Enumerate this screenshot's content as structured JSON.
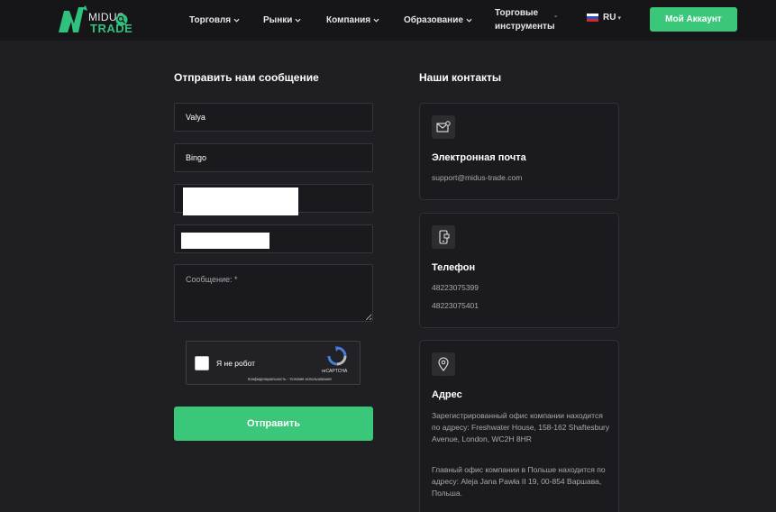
{
  "header": {
    "logo": {
      "word_top": "MIDUS",
      "word_bottom": "TRADE",
      "accent": "#2ec27e"
    },
    "nav": [
      {
        "label": "Торговля",
        "icon": "chevron-down-icon"
      },
      {
        "label": "Рынки",
        "icon": "chevron-down-icon"
      },
      {
        "label": "Компания",
        "icon": "chevron-down-icon"
      },
      {
        "label": "Образование",
        "icon": "chevron-down-icon"
      }
    ],
    "instruments": {
      "line1": "Торговые",
      "line2": "инструменты",
      "marker": "-"
    },
    "language": {
      "label": "RU",
      "icon": "russia-flag-icon"
    },
    "account_button": "Мой Аккаунт"
  },
  "form": {
    "title": "Отправить нам сообщение",
    "first_name": "Valya",
    "last_name": "Bingo",
    "message_placeholder": "Сообщение: *",
    "captcha": {
      "label": "Я не робот",
      "brand": "reCAPTCHA",
      "links": "Конфиденциальность - Условия использования"
    },
    "submit_label": "Отправить"
  },
  "contacts": {
    "title": "Наши контакты",
    "email": {
      "title": "Электронная почта",
      "value": "support@midus-trade.com",
      "icon": "mail-icon"
    },
    "phone": {
      "title": "Телефон",
      "numbers": [
        "48223075399",
        "48223075401"
      ],
      "icon": "phone-icon"
    },
    "address": {
      "title": "Адрес",
      "registered": "Зарегистрированный офис компании находится по адресу: Freshwater House, 158-162 Shaftesbury Avenue, London, WC2H 8HR",
      "main": "Главный офис компании в Польше находится по адресу: Aleja Jana Pawła II 19, 00-854 Варшава, Польша.",
      "icon": "location-pin-icon"
    }
  },
  "colors": {
    "accent": "#3ac779",
    "background": "#1f1f23",
    "header": "#161619"
  }
}
